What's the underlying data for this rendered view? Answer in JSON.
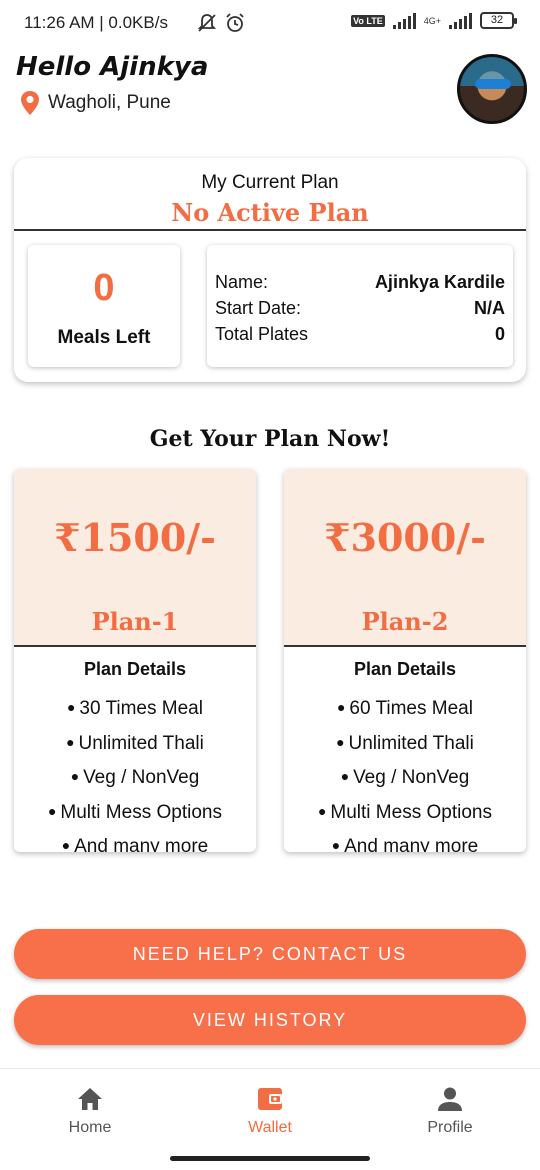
{
  "status_bar": {
    "text": "11:26 AM | 0.0KB/s",
    "network_tag": "4G+",
    "volte_label": "Vo LTE",
    "battery": "32"
  },
  "header": {
    "greeting": "Hello Ajinkya",
    "location": "Wagholi, Pune"
  },
  "current_plan": {
    "title": "My Current Plan",
    "status": "No Active Plan",
    "meals_left_value": "0",
    "meals_left_label": "Meals Left",
    "rows": [
      {
        "label": "Name:",
        "value": "Ajinkya Kardile"
      },
      {
        "label": "Start Date:",
        "value": "N/A"
      },
      {
        "label": "Total Plates",
        "value": "0"
      }
    ]
  },
  "plans_section": {
    "heading": "Get Your Plan Now!",
    "plans": [
      {
        "price": "₹1500/-",
        "name": "Plan-1",
        "details_title": "Plan Details",
        "features": [
          "30 Times Meal",
          "Unlimited Thali",
          "Veg / NonVeg",
          "Multi Mess Options",
          "And many more"
        ]
      },
      {
        "price": "₹3000/-",
        "name": "Plan-2",
        "details_title": "Plan Details",
        "features": [
          "60 Times Meal",
          "Unlimited Thali",
          "Veg / NonVeg",
          "Multi Mess Options",
          "And many more"
        ]
      }
    ]
  },
  "buttons": {
    "help": "NEED HELP? CONTACT US",
    "history": "VIEW HISTORY"
  },
  "nav": {
    "items": [
      {
        "label": "Home",
        "icon": "home-icon"
      },
      {
        "label": "Wallet",
        "icon": "wallet-icon",
        "active": true
      },
      {
        "label": "Profile",
        "icon": "profile-icon"
      }
    ]
  },
  "colors": {
    "accent": "#f26d43",
    "button": "#f7704a",
    "plan_header_bg": "#fbece2"
  }
}
